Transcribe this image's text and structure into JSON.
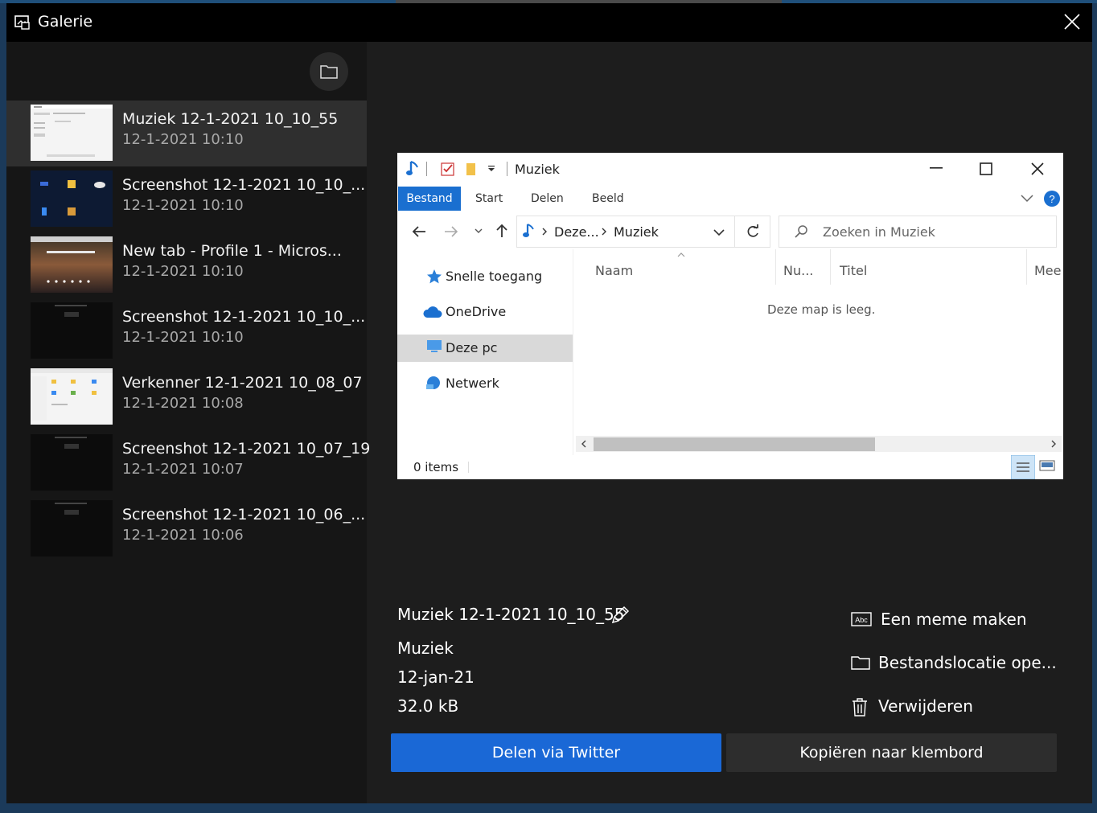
{
  "window": {
    "title": "Galerie"
  },
  "gallery": {
    "items": [
      {
        "name": "Muziek 12-1-2021 10_10_55",
        "date": "12-1-2021 10:10",
        "selected": true
      },
      {
        "name": "Screenshot 12-1-2021 10_10_...",
        "date": "12-1-2021 10:10"
      },
      {
        "name": "New tab - Profile 1 - Micros...",
        "date": "12-1-2021 10:10"
      },
      {
        "name": "Screenshot 12-1-2021 10_10_...",
        "date": "12-1-2021 10:10"
      },
      {
        "name": "Verkenner 12-1-2021 10_08_07",
        "date": "12-1-2021 10:08"
      },
      {
        "name": "Screenshot 12-1-2021 10_07_19",
        "date": "12-1-2021 10:07"
      },
      {
        "name": "Screenshot 12-1-2021 10_06_...",
        "date": "12-1-2021 10:06"
      }
    ]
  },
  "preview": {
    "window_title": "Muziek",
    "ribbon_tabs": [
      "Bestand",
      "Start",
      "Delen",
      "Beeld"
    ],
    "breadcrumb": [
      "Deze...",
      "Muziek"
    ],
    "search_placeholder": "Zoeken in Muziek",
    "nav": [
      "Snelle toegang",
      "OneDrive",
      "Deze pc",
      "Netwerk"
    ],
    "columns": [
      "Naam",
      "Nu...",
      "Titel",
      "Mee"
    ],
    "empty_text": "Deze map is leeg.",
    "status": "0 items"
  },
  "details": {
    "filename": "Muziek 12-1-2021 10_10_55",
    "app": "Muziek",
    "date": "12-jan-21",
    "size": "32.0 kB"
  },
  "actions": {
    "meme": "Een meme maken",
    "open_location": "Bestandslocatie ope...",
    "delete": "Verwijderen"
  },
  "buttons": {
    "share_twitter": "Delen via Twitter",
    "copy_clipboard": "Kopiëren naar klembord"
  },
  "colors": {
    "accent": "#1a68d6",
    "explorer_tab": "#1a6fd0"
  }
}
